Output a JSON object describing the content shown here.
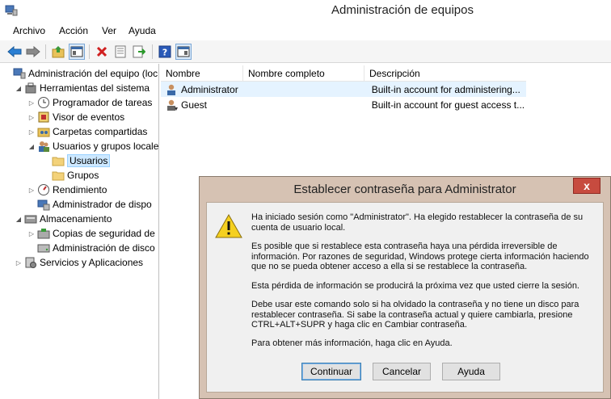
{
  "window": {
    "title": "Administración de equipos"
  },
  "menu": [
    "Archivo",
    "Acción",
    "Ver",
    "Ayuda"
  ],
  "toolbar": {
    "icons": [
      "back-arrow-icon",
      "forward-arrow-icon",
      "up-folder-icon",
      "show-hide-tree-icon",
      "delete-icon",
      "properties-icon",
      "export-icon",
      "help-icon",
      "action-pane-icon"
    ]
  },
  "tree": {
    "items": [
      {
        "label": "Administración del equipo (loc",
        "icon": "computer-management-icon",
        "level": 0,
        "arrow": ""
      },
      {
        "label": "Herramientas del sistema",
        "icon": "tools-icon",
        "level": 1,
        "arrow": "open"
      },
      {
        "label": "Programador de tareas",
        "icon": "clock-icon",
        "level": 2,
        "arrow": "closed"
      },
      {
        "label": "Visor de eventos",
        "icon": "event-viewer-icon",
        "level": 2,
        "arrow": "closed"
      },
      {
        "label": "Carpetas compartidas",
        "icon": "shared-folder-icon",
        "level": 2,
        "arrow": "closed"
      },
      {
        "label": "Usuarios y grupos locale",
        "icon": "users-icon",
        "level": 2,
        "arrow": "open"
      },
      {
        "label": "Usuarios",
        "icon": "folder-icon",
        "level": 3,
        "arrow": "",
        "selected": true
      },
      {
        "label": "Grupos",
        "icon": "folder-icon",
        "level": 3,
        "arrow": ""
      },
      {
        "label": "Rendimiento",
        "icon": "performance-icon",
        "level": 2,
        "arrow": "closed"
      },
      {
        "label": "Administrador de dispo",
        "icon": "device-manager-icon",
        "level": 2,
        "arrow": ""
      },
      {
        "label": "Almacenamiento",
        "icon": "storage-icon",
        "level": 1,
        "arrow": "open"
      },
      {
        "label": "Copias de seguridad de",
        "icon": "backup-icon",
        "level": 2,
        "arrow": "closed"
      },
      {
        "label": "Administración de disco",
        "icon": "disk-icon",
        "level": 2,
        "arrow": ""
      },
      {
        "label": "Servicios y Aplicaciones",
        "icon": "services-icon",
        "level": 1,
        "arrow": "closed"
      }
    ]
  },
  "list": {
    "columns": [
      "Nombre",
      "Nombre completo",
      "Descripción"
    ],
    "rows": [
      {
        "name": "Administrator",
        "fullname": "",
        "description": "Built-in account for administering...",
        "icon": "user-icon"
      },
      {
        "name": "Guest",
        "fullname": "",
        "description": "Built-in account for guest access t...",
        "icon": "guest-user-icon"
      }
    ]
  },
  "dialog": {
    "title": "Establecer contraseña para Administrator",
    "close_label": "x",
    "paragraphs": [
      "Ha iniciado sesión como \"Administrator\". Ha elegido restablecer la contraseña de su cuenta de usuario local.",
      "Es posible que si restablece esta contraseña haya una pérdida irreversible de información. Por razones de seguridad, Windows protege cierta información haciendo que no se pueda obtener acceso a ella si se restablece la contraseña.",
      "Esta pérdida de información se producirá la próxima vez que usted cierre la sesión.",
      "Debe usar este comando solo si ha olvidado la contraseña y no tiene un disco para restablecer contraseña. Si sabe la contraseña actual y quiere cambiarla, presione CTRL+ALT+SUPR y haga clic en Cambiar contraseña.",
      "Para obtener más información, haga clic en Ayuda."
    ],
    "buttons": {
      "continue": "Continuar",
      "cancel": "Cancelar",
      "help": "Ayuda"
    }
  },
  "colors": {
    "dialog_frame": "#d6c2b3",
    "close_button": "#c74b3f",
    "selection": "#cde8ff"
  }
}
